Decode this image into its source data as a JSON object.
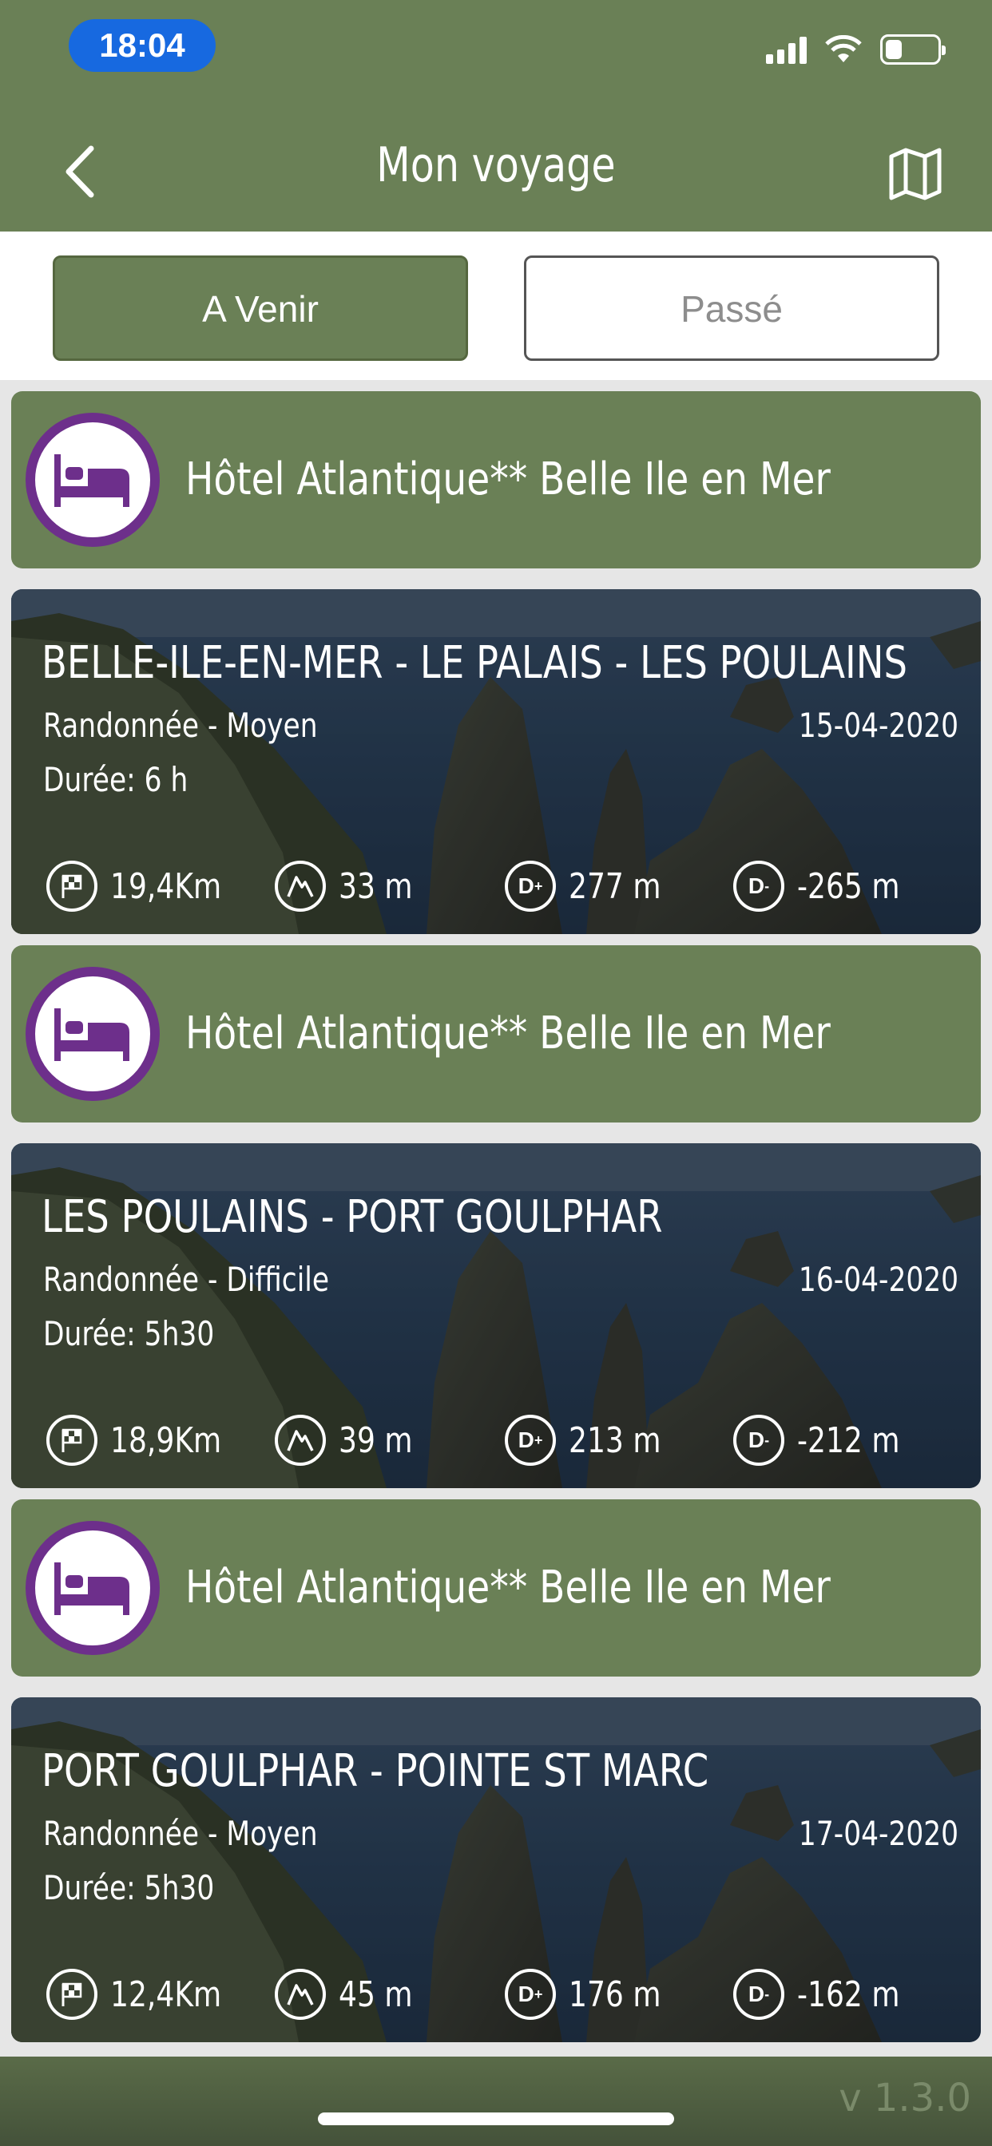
{
  "status_bar": {
    "time": "18:04"
  },
  "header": {
    "title": "Mon voyage"
  },
  "tabs": {
    "upcoming": "A Venir",
    "past": "Passé"
  },
  "items": [
    {
      "kind": "hotel",
      "name": "Hôtel Atlantique** Belle Ile en Mer"
    },
    {
      "kind": "hike",
      "title": "BELLE-ILE-EN-MER - LE PALAIS - LES POULAINS",
      "type": "Randonnée - Moyen",
      "date": "15-04-2020",
      "duration": "Durée: 6 h",
      "distance": "19,4Km",
      "altitude": "33 m",
      "ascent": "277 m",
      "descent": "-265 m"
    },
    {
      "kind": "hotel",
      "name": "Hôtel Atlantique** Belle Ile en Mer"
    },
    {
      "kind": "hike",
      "title": "LES POULAINS - PORT GOULPHAR",
      "type": "Randonnée - Difficile",
      "date": "16-04-2020",
      "duration": "Durée: 5h30",
      "distance": "18,9Km",
      "altitude": "39 m",
      "ascent": "213 m",
      "descent": "-212 m"
    },
    {
      "kind": "hotel",
      "name": "Hôtel Atlantique** Belle Ile en Mer"
    },
    {
      "kind": "hike",
      "title": "PORT GOULPHAR - POINTE ST MARC",
      "type": "Randonnée - Moyen",
      "date": "17-04-2020",
      "duration": "Durée: 5h30",
      "distance": "12,4Km",
      "altitude": "45 m",
      "ascent": "176 m",
      "descent": "-162 m"
    }
  ],
  "footer": {
    "version": "v 1.3.0"
  },
  "icons": {
    "back": "chevron-left-icon",
    "map": "map-icon",
    "hotel": "bed-icon",
    "distance": "checkered-flag-icon",
    "altitude": "mountain-icon",
    "ascent": "d-plus-icon",
    "descent": "d-minus-icon"
  },
  "colors": {
    "header_green": "#6a8056",
    "hotel_circle": "#6d2f8b",
    "status_pill": "#1769e0"
  }
}
